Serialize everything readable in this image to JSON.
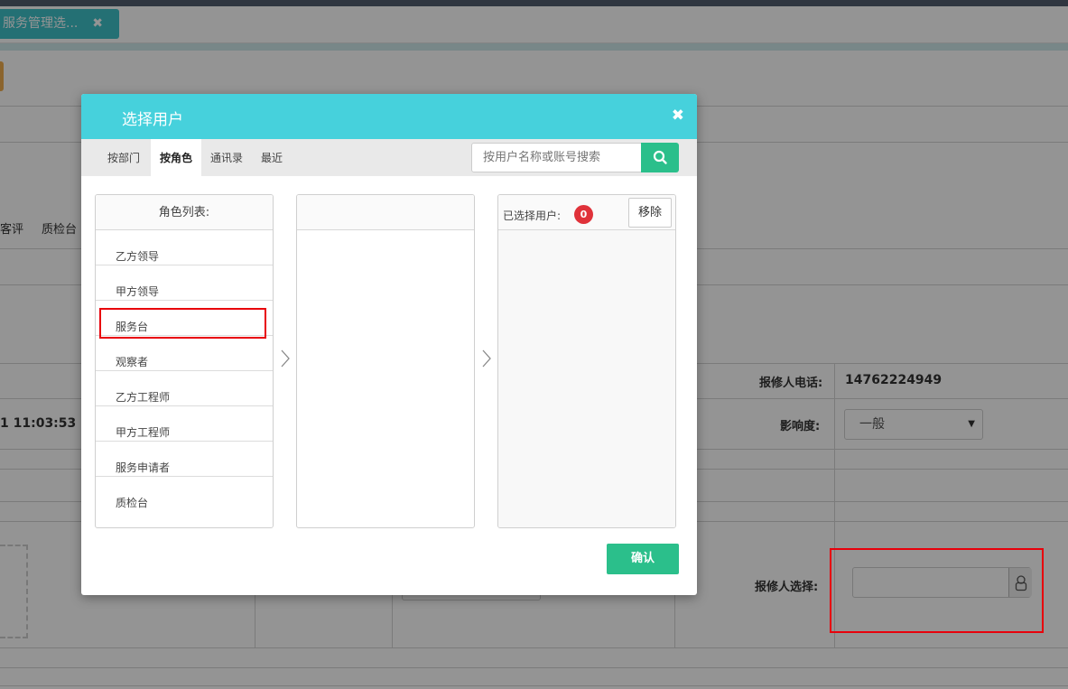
{
  "window": {
    "tab_label": "服务管理选...",
    "tab_close": "✖"
  },
  "background": {
    "nav_items": [
      "客评",
      "质检台"
    ],
    "datetime_fragment": "1 11:03:53",
    "phone_label": "报修人电话:",
    "phone_value": "14762224949",
    "impact_label": "影响度:",
    "impact_value": "一般",
    "reporter_label": "报修人选择:",
    "reporter_value": ""
  },
  "modal": {
    "title": "选择用户",
    "close": "✖",
    "tabs": [
      {
        "label": "按部门",
        "active": false
      },
      {
        "label": "按角色",
        "active": true
      },
      {
        "label": "通讯录",
        "active": false
      },
      {
        "label": "最近",
        "active": false
      }
    ],
    "search_placeholder": "按用户名称或账号搜索",
    "role_list": {
      "header": "角色列表:",
      "items": [
        "乙方领导",
        "甲方领导",
        "服务台",
        "观察者",
        "乙方工程师",
        "甲方工程师",
        "服务申请者",
        "质检台"
      ]
    },
    "selected": {
      "label": "已选择用户:",
      "count": "0",
      "remove_label": "移除"
    },
    "confirm_label": "确认"
  },
  "colors": {
    "header": "#46d1dc",
    "primary_button": "#2bbf8b",
    "badge": "#e0323a",
    "annotation": "#e8000b",
    "tab_active": "#3fc1c9"
  }
}
